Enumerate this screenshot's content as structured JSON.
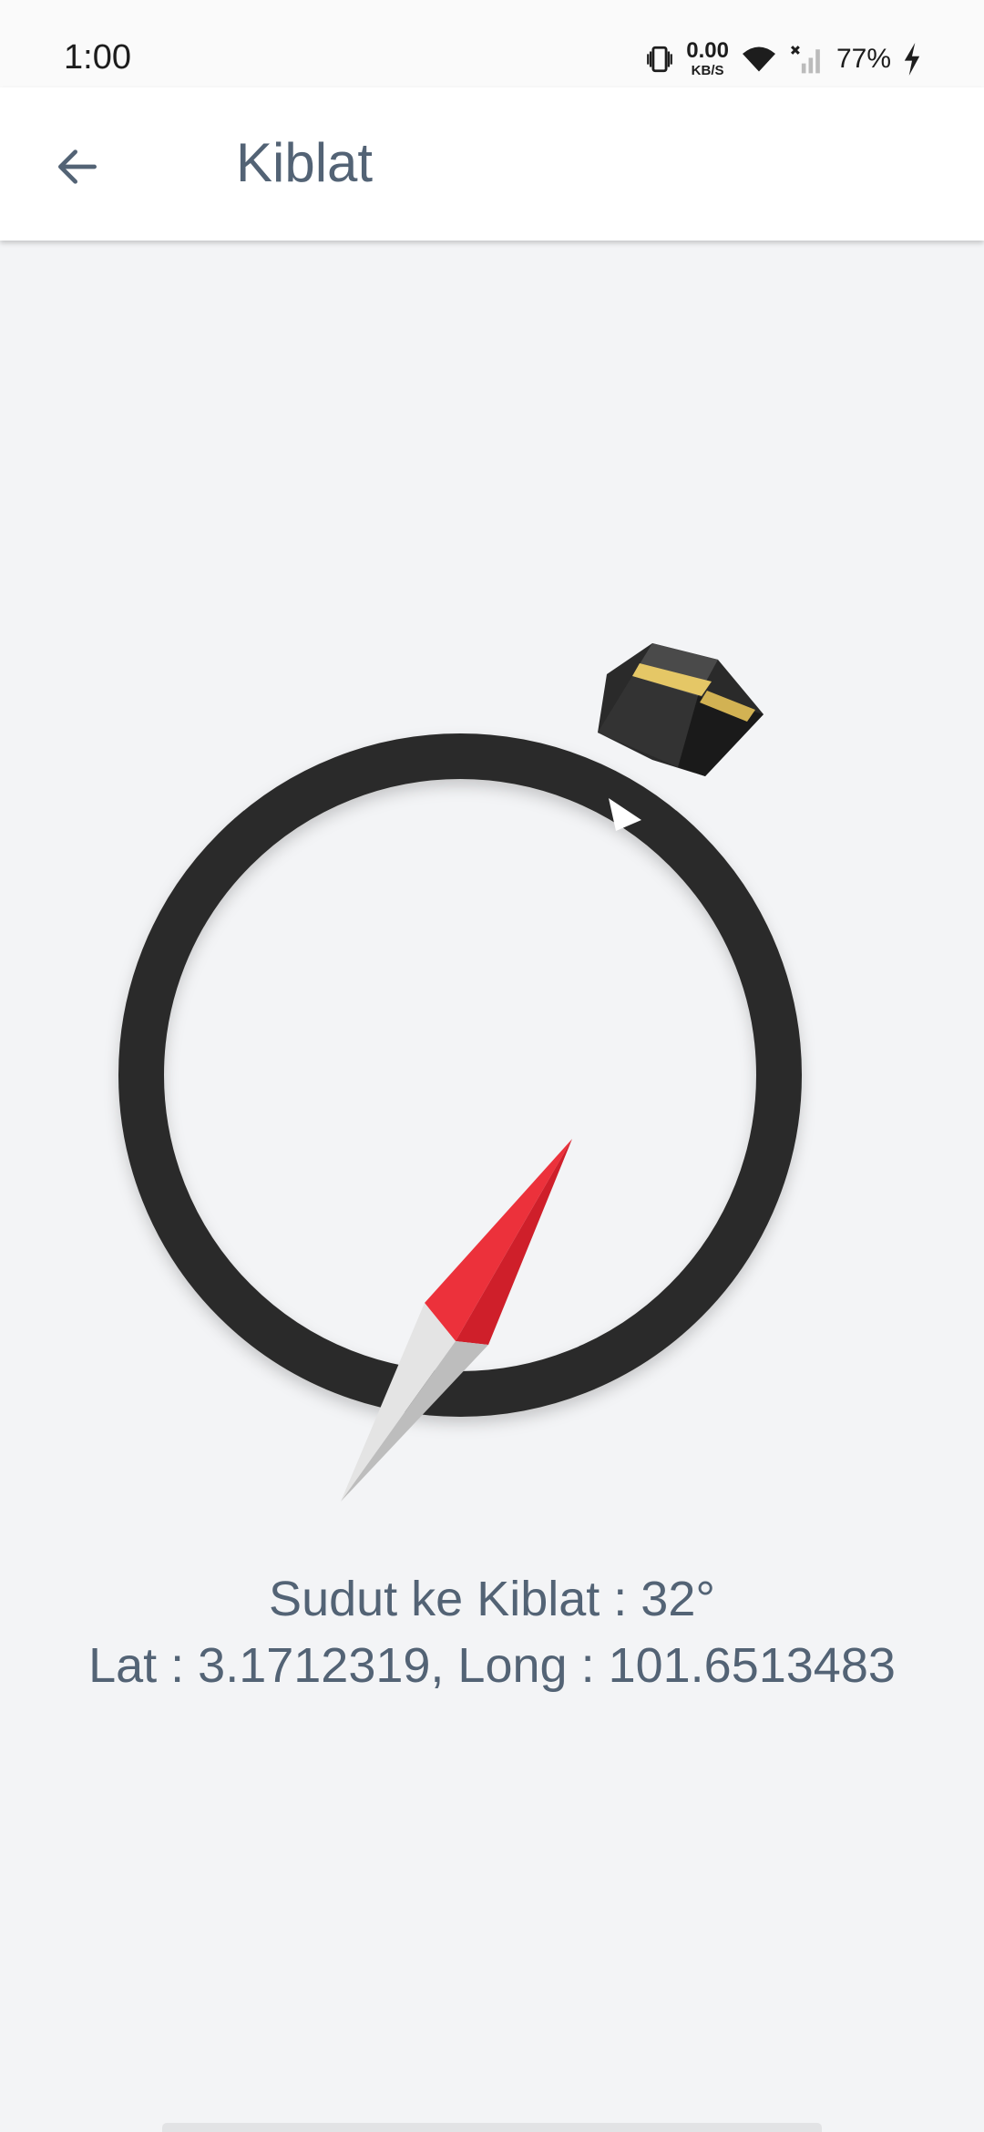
{
  "status_bar": {
    "time": "1:00",
    "net_speed_value": "0.00",
    "net_speed_unit": "KB/S",
    "battery": "77%",
    "icons": [
      "vibrate-icon",
      "wifi-icon",
      "no-signal-icon",
      "charging-icon"
    ]
  },
  "app_bar": {
    "title": "Kiblat",
    "back_icon": "arrow-left-icon"
  },
  "compass": {
    "qibla_angle_deg": 32,
    "ring_color": "#2b2a29",
    "needle_north_color": "#e8333a",
    "needle_south_color": "#e0e0e0",
    "kaaba_icon": "kaaba-icon"
  },
  "info": {
    "angle_text": "Sudut ke Kiblat : 32°",
    "coords_text": "Lat : 3.1712319, Long : 101.6513483"
  },
  "colors": {
    "background": "#f3f4f6",
    "text": "#536375",
    "app_bar": "#ffffff"
  }
}
